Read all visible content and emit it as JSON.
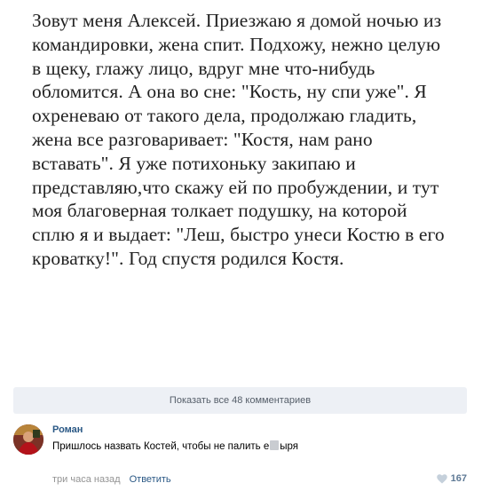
{
  "post": {
    "text": "Зовут меня Алексей. Приезжаю я домой ночью из командировки, жена спит. Подхожу, нежно целую в щеку, глажу лицо, вдруг мне что-нибудь обломится. А она во сне: \"Кость, ну спи уже\". Я охреневаю от такого дела, продолжаю гладить, жена все разговаривает: \"Костя, нам рано вставать\". Я уже потихоньку закипаю и представляю,что скажу ей по пробуждении, и тут моя благоверная толкает подушку, на которой сплю я и выдает: \"Леш, быстро унеси Костю в его кроватку!\". Год спустя родился Костя."
  },
  "comments": {
    "show_all_label": "Показать все 48 комментариев"
  },
  "comment": {
    "author": "Роман",
    "text_before": "Пришлось назвать Костей, чтобы не палить е",
    "text_after": "ыря",
    "time": "три часа назад",
    "reply_label": "Ответить",
    "likes": "167",
    "like_icon": "heart-icon"
  },
  "colors": {
    "link": "#2a5885",
    "muted": "#939393",
    "panel": "#edf0f5"
  }
}
